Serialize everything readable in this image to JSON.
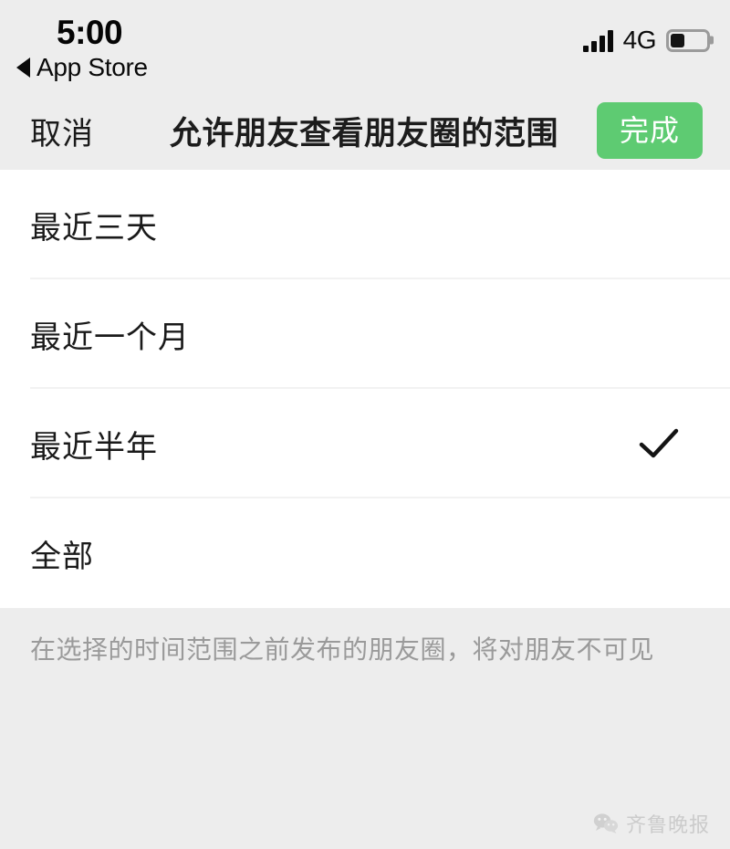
{
  "status_bar": {
    "time": "5:00",
    "back_label": "App Store",
    "back_icon": "triangle-left-icon",
    "signal_icon": "signal-bars-icon",
    "network": "4G",
    "battery_icon": "battery-icon",
    "battery_level_percent": 40
  },
  "nav_bar": {
    "cancel_label": "取消",
    "title": "允许朋友查看朋友圈的范围",
    "done_label": "完成",
    "done_color": "#5ecb72"
  },
  "options": [
    {
      "label": "最近三天",
      "selected": false
    },
    {
      "label": "最近一个月",
      "selected": false
    },
    {
      "label": "最近半年",
      "selected": true
    },
    {
      "label": "全部",
      "selected": false
    }
  ],
  "check_icon": "checkmark-icon",
  "footer": {
    "note": "在选择的时间范围之前发布的朋友圈，将对朋友不可见"
  },
  "watermark": {
    "logo_icon": "wechat-bubbles-icon",
    "text": "齐鲁晚报"
  }
}
